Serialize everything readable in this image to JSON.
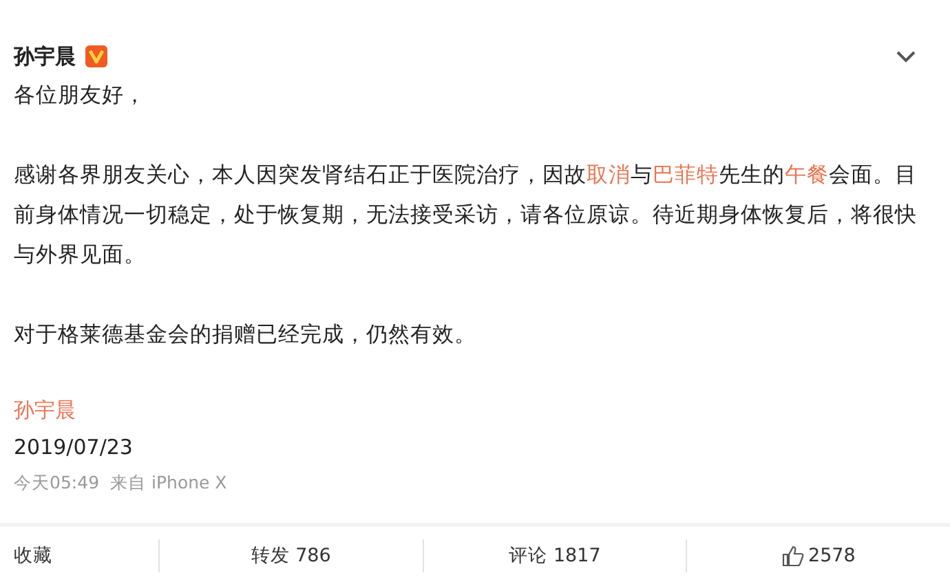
{
  "author": {
    "name": "孙宇晨",
    "verified": true
  },
  "post": {
    "greeting": "各位朋友好，",
    "paragraphs": [
      [
        {
          "kind": "text",
          "text": "感谢各界朋友关心，本人因突发肾结石正于医院治疗，因故"
        },
        {
          "kind": "link",
          "text": "取消"
        },
        {
          "kind": "text",
          "text": "与"
        },
        {
          "kind": "link",
          "text": "巴菲特"
        },
        {
          "kind": "text",
          "text": "先生的"
        },
        {
          "kind": "link",
          "text": "午餐"
        },
        {
          "kind": "text",
          "text": "会面。目前身体情况一切稳定，处于恢复期，无法接受采访，请各位原谅。待近期身体恢复后，将很快与外界见面。"
        }
      ],
      [
        {
          "kind": "text",
          "text": "对于格莱德基金会的捐赠已经完成，仍然有效。"
        }
      ]
    ],
    "signature": "孙宇晨",
    "date": "2019/07/23"
  },
  "meta": {
    "time": "今天05:49",
    "source": "来自 iPhone X"
  },
  "actions": [
    {
      "kind": "favorite",
      "label": "收藏"
    },
    {
      "kind": "repost",
      "label": "转发 786"
    },
    {
      "kind": "comment",
      "label": "评论 1817"
    },
    {
      "kind": "like",
      "label": "2578"
    }
  ]
}
